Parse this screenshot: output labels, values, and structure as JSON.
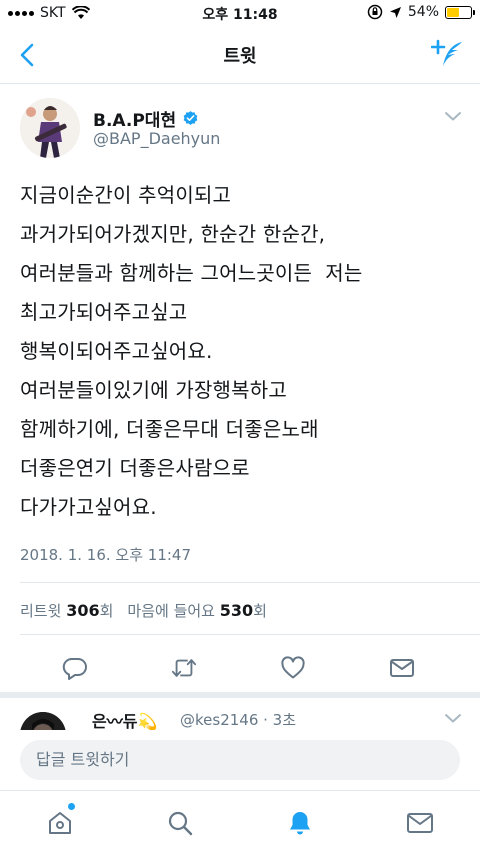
{
  "status_bar": {
    "carrier": "SKT",
    "time": "오후 11:48",
    "battery": "54%",
    "battery_level": 0.54
  },
  "nav": {
    "title": "트윗"
  },
  "tweet": {
    "author_name": "B.A.P대현",
    "author_handle": "@BAP_Daehyun",
    "body": "지금이순간이 추억이되고\n과거가되어가겠지만, 한순간 한순간,\n여러분들과 함께하는 그어느곳이든  저는\n최고가되어주고싶고\n행복이되어주고싶어요.\n여러분들이있기에 가장행복하고\n함께하기에, 더좋은무대 더좋은노래\n더좋은연기 더좋은사람으로\n다가가고싶어요.",
    "timestamp": "2018. 1. 16. 오후 11:47",
    "retweet_label": "리트윗",
    "retweet_count": "306",
    "count_unit": "회",
    "like_label": "마음에 들어요",
    "like_count": "530"
  },
  "reply_preview": {
    "name": "은〰듀💫",
    "meta": "@kes2146 · 3초"
  },
  "reply_composer": {
    "placeholder": "답글 트윗하기"
  },
  "colors": {
    "accent": "#1da1f2",
    "muted": "#657786",
    "battery": "#ffcc00"
  }
}
